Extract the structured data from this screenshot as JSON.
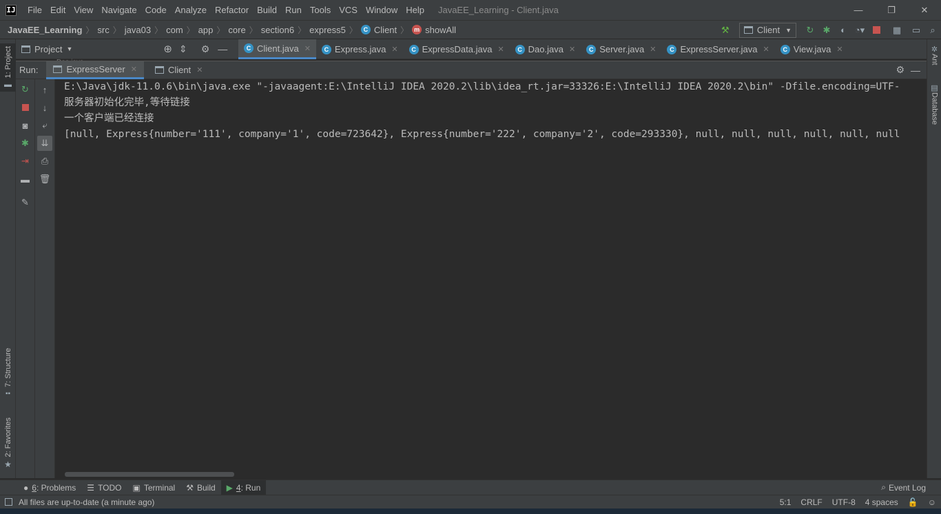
{
  "menubar": {
    "items": [
      "File",
      "Edit",
      "View",
      "Navigate",
      "Code",
      "Analyze",
      "Refactor",
      "Build",
      "Run",
      "Tools",
      "VCS",
      "Window",
      "Help"
    ],
    "window_title": "JavaEE_Learning - Client.java",
    "logo_text": "IJ"
  },
  "breadcrumb": {
    "project": "JavaEE_Learning",
    "parts": [
      "src",
      "java03",
      "com",
      "app",
      "core",
      "section6",
      "express5"
    ],
    "class_name": "Client",
    "method_name": "showAll"
  },
  "toolbar": {
    "run_config": "Client"
  },
  "project_panel": {
    "title": "Project",
    "behind_text": "Dao.java"
  },
  "editor_tabs": [
    {
      "label": "Client.java",
      "active": true
    },
    {
      "label": "Express.java",
      "active": false
    },
    {
      "label": "ExpressData.java",
      "active": false
    },
    {
      "label": "Dao.java",
      "active": false
    },
    {
      "label": "Server.java",
      "active": false
    },
    {
      "label": "ExpressServer.java",
      "active": false
    },
    {
      "label": "View.java",
      "active": false
    }
  ],
  "left_strip": {
    "project": "1: Project",
    "structure": "7: Structure",
    "favorites": "2: Favorites"
  },
  "right_strip": {
    "ant": "Ant",
    "database": "Database"
  },
  "run_panel": {
    "label": "Run:",
    "tabs": [
      {
        "label": "ExpressServer",
        "active": true
      },
      {
        "label": "Client",
        "active": false
      }
    ]
  },
  "console": {
    "lines": [
      "E:\\Java\\jdk-11.0.6\\bin\\java.exe \"-javaagent:E:\\IntelliJ IDEA 2020.2\\lib\\idea_rt.jar=33326:E:\\IntelliJ IDEA 2020.2\\bin\" -Dfile.encoding=UTF-",
      "服务器初始化完毕,等待链接",
      "一个客户端已经连接",
      "[null, Express{number='111', company='1', code=723642}, Express{number='222', company='2', code=293330}, null, null, null, null, null, null"
    ]
  },
  "bottom_tools": {
    "problems_key": "6",
    "problems": ": Problems",
    "todo": "TODO",
    "terminal": "Terminal",
    "build": "Build",
    "run_key": "4",
    "run": ": Run",
    "event_log": "Event Log"
  },
  "status_bar": {
    "message": "All files are up-to-date (a minute ago)",
    "position": "5:1",
    "line_sep": "CRLF",
    "encoding": "UTF-8",
    "indent": "4 spaces"
  }
}
